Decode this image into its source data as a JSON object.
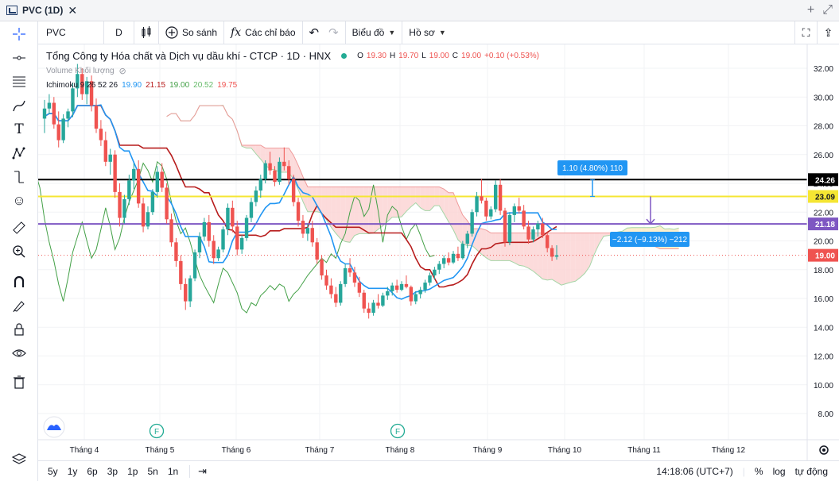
{
  "window": {
    "tab_title": "PVC (1D)",
    "close_glyph": "✕",
    "add_glyph": "+",
    "expand_glyph": "⤢"
  },
  "toolbar": {
    "symbol": "PVC",
    "interval": "D",
    "compare": "So sánh",
    "indicators": "Các chỉ báo",
    "undo_glyph": "↶",
    "redo_glyph": "↷",
    "chart_type": "Biểu đồ",
    "profile": "Hồ sơ",
    "fullscreen_glyph": "⛶",
    "share_glyph": "⇪"
  },
  "legend": {
    "title": "Tổng Công ty Hóa chất và Dịch vụ dầu khí - CTCP · 1D · HNX",
    "o_label": "O",
    "o": "19.30",
    "h_label": "H",
    "h": "19.70",
    "l_label": "L",
    "l": "19.00",
    "c_label": "C",
    "c": "19.00",
    "change": "+0.10 (+0.53%)",
    "volume": "Volume Khối lượng",
    "ichimoku_label": "Ichimoku 9 26 52 26",
    "ichimoku_values": [
      "19.90",
      "21.15",
      "19.00",
      "20.52",
      "19.75"
    ]
  },
  "colors": {
    "up": "#26a69a",
    "down": "#ef5350",
    "conversion": "#2196f3",
    "base": "#b71c1c",
    "lagging": "#43a047",
    "line_black": "#000000",
    "line_yellow": "#f5e633",
    "line_purple": "#7e57c2",
    "cloud_up": "#fbecc4",
    "cloud_down": "#fbd5d5",
    "measure": "#2196f3"
  },
  "price_axis": {
    "labels": [
      "32.00",
      "30.00",
      "28.00",
      "26.00",
      "24.00",
      "22.00",
      "20.00",
      "18.00",
      "16.00",
      "14.00",
      "12.00",
      "10.00",
      "8.00"
    ],
    "tags": [
      {
        "value": "24.26",
        "bg": "#000000",
        "fg": "#ffffff"
      },
      {
        "value": "23.09",
        "bg": "#f5e633",
        "fg": "#131722"
      },
      {
        "value": "21.18",
        "bg": "#7e57c2",
        "fg": "#ffffff"
      },
      {
        "value": "19.00",
        "bg": "#ef5350",
        "fg": "#ffffff"
      }
    ]
  },
  "time_axis": [
    "Tháng 4",
    "Tháng 5",
    "Tháng 6",
    "Tháng 7",
    "Tháng 8",
    "Tháng 9",
    "Tháng 10",
    "Tháng 11",
    "Tháng 12"
  ],
  "markers": [
    "F",
    "F"
  ],
  "measure_labels": [
    "1.10 (4.80%) 110",
    "−2.12 (−9.13%) −212"
  ],
  "bottom": {
    "ranges": [
      "5y",
      "1y",
      "6p",
      "3p",
      "1p",
      "5n",
      "1n"
    ],
    "time": "14:18:06 (UTC+7)",
    "percent": "%",
    "log": "log",
    "auto": "tự động"
  },
  "chart_data": {
    "type": "candlestick",
    "symbol": "PVC",
    "interval": "1D",
    "ylim": [
      7,
      33
    ],
    "horizontal_lines": [
      24.26,
      23.09,
      21.18
    ],
    "last_close": 19.0,
    "candles_ohlc": [
      [
        28.5,
        29.8,
        27.5,
        29.2
      ],
      [
        29.2,
        30.2,
        28.8,
        29.6
      ],
      [
        29.6,
        30.0,
        27.8,
        28.1
      ],
      [
        28.1,
        29.0,
        26.5,
        27.0
      ],
      [
        27.0,
        28.8,
        26.8,
        28.5
      ],
      [
        28.5,
        29.2,
        27.9,
        29.0
      ],
      [
        29.0,
        31.0,
        28.6,
        30.6
      ],
      [
        30.6,
        32.3,
        30.0,
        31.6
      ],
      [
        31.6,
        32.0,
        29.8,
        30.2
      ],
      [
        30.2,
        31.4,
        29.5,
        31.1
      ],
      [
        31.1,
        31.5,
        29.0,
        29.4
      ],
      [
        29.4,
        29.9,
        27.5,
        27.8
      ],
      [
        27.8,
        28.4,
        26.6,
        27.0
      ],
      [
        27.0,
        27.6,
        25.2,
        25.5
      ],
      [
        25.5,
        26.4,
        24.6,
        26.0
      ],
      [
        26.0,
        26.3,
        23.0,
        23.4
      ],
      [
        23.4,
        24.0,
        21.0,
        21.6
      ],
      [
        21.6,
        23.2,
        21.2,
        22.9
      ],
      [
        22.9,
        24.6,
        22.5,
        24.2
      ],
      [
        24.2,
        25.4,
        23.6,
        25.0
      ],
      [
        25.0,
        25.6,
        22.3,
        22.6
      ],
      [
        22.6,
        23.0,
        20.6,
        21.0
      ],
      [
        21.0,
        22.4,
        20.8,
        22.0
      ],
      [
        22.0,
        23.6,
        21.8,
        23.4
      ],
      [
        23.4,
        25.2,
        23.0,
        24.8
      ],
      [
        24.8,
        25.4,
        23.4,
        23.7
      ],
      [
        23.7,
        24.0,
        21.2,
        21.5
      ],
      [
        21.5,
        21.9,
        19.6,
        19.9
      ],
      [
        19.9,
        20.2,
        18.2,
        18.6
      ],
      [
        18.6,
        19.0,
        16.6,
        17.0
      ],
      [
        17.0,
        17.4,
        15.2,
        15.8
      ],
      [
        15.8,
        17.6,
        15.4,
        17.4
      ],
      [
        17.4,
        19.4,
        17.2,
        19.2
      ],
      [
        19.2,
        20.6,
        18.8,
        20.3
      ],
      [
        20.3,
        21.6,
        20.0,
        21.3
      ],
      [
        21.3,
        21.8,
        19.6,
        20.0
      ],
      [
        20.0,
        20.4,
        18.4,
        18.8
      ],
      [
        18.8,
        19.6,
        18.6,
        19.4
      ],
      [
        19.4,
        21.0,
        19.2,
        20.8
      ],
      [
        20.8,
        22.6,
        20.4,
        22.3
      ],
      [
        22.3,
        22.8,
        20.6,
        21.0
      ],
      [
        21.0,
        21.4,
        19.0,
        19.4
      ],
      [
        19.4,
        20.4,
        19.1,
        20.2
      ],
      [
        20.2,
        21.8,
        20.0,
        21.6
      ],
      [
        21.6,
        23.0,
        21.3,
        22.7
      ],
      [
        22.7,
        23.8,
        22.4,
        23.5
      ],
      [
        23.5,
        24.6,
        23.0,
        24.3
      ],
      [
        24.3,
        25.6,
        24.0,
        25.4
      ],
      [
        25.4,
        26.2,
        24.6,
        24.9
      ],
      [
        24.9,
        25.2,
        23.8,
        24.1
      ],
      [
        24.1,
        25.8,
        23.9,
        25.5
      ],
      [
        25.5,
        26.5,
        24.9,
        25.2
      ],
      [
        25.2,
        25.6,
        23.9,
        24.3
      ],
      [
        24.3,
        24.6,
        22.4,
        22.7
      ],
      [
        22.7,
        23.0,
        21.0,
        21.4
      ],
      [
        21.4,
        21.8,
        20.2,
        20.5
      ],
      [
        20.5,
        21.2,
        20.0,
        20.9
      ],
      [
        20.9,
        21.4,
        19.6,
        19.9
      ],
      [
        19.9,
        20.2,
        18.4,
        18.7
      ],
      [
        18.7,
        19.0,
        17.3,
        17.6
      ],
      [
        17.6,
        18.0,
        16.6,
        16.9
      ],
      [
        16.9,
        17.4,
        16.0,
        16.3
      ],
      [
        16.3,
        16.8,
        15.4,
        15.7
      ],
      [
        15.7,
        17.2,
        15.5,
        17.0
      ],
      [
        17.0,
        18.4,
        16.8,
        18.1
      ],
      [
        18.1,
        18.8,
        17.5,
        17.8
      ],
      [
        17.8,
        18.2,
        16.8,
        17.1
      ],
      [
        17.1,
        17.5,
        16.1,
        16.4
      ],
      [
        16.4,
        16.6,
        15.0,
        15.3
      ],
      [
        15.3,
        15.7,
        14.6,
        15.0
      ],
      [
        15.0,
        15.9,
        14.8,
        15.7
      ],
      [
        15.7,
        16.3,
        15.3,
        15.5
      ],
      [
        15.5,
        16.4,
        15.4,
        16.2
      ],
      [
        16.2,
        16.8,
        15.9,
        16.5
      ],
      [
        16.5,
        17.1,
        16.2,
        16.9
      ],
      [
        16.9,
        17.3,
        16.4,
        16.6
      ],
      [
        16.6,
        17.2,
        16.5,
        17.0
      ],
      [
        17.0,
        17.6,
        16.7,
        16.8
      ],
      [
        16.8,
        16.9,
        15.5,
        15.8
      ],
      [
        15.8,
        16.5,
        15.6,
        16.3
      ],
      [
        16.3,
        16.8,
        16.0,
        16.6
      ],
      [
        16.6,
        17.3,
        16.4,
        17.1
      ],
      [
        17.1,
        17.8,
        16.9,
        17.6
      ],
      [
        17.6,
        18.2,
        17.3,
        18.0
      ],
      [
        18.0,
        18.6,
        17.7,
        18.4
      ],
      [
        18.4,
        19.0,
        18.1,
        18.8
      ],
      [
        18.8,
        19.2,
        18.3,
        18.5
      ],
      [
        18.5,
        19.3,
        18.4,
        19.1
      ],
      [
        19.1,
        19.6,
        18.6,
        18.8
      ],
      [
        18.8,
        20.0,
        18.7,
        19.8
      ],
      [
        19.8,
        20.7,
        19.5,
        20.5
      ],
      [
        20.5,
        22.2,
        20.3,
        22.0
      ],
      [
        22.0,
        23.4,
        21.7,
        23.1
      ],
      [
        23.1,
        24.3,
        22.6,
        22.8
      ],
      [
        22.8,
        23.0,
        21.4,
        21.7
      ],
      [
        21.7,
        22.4,
        21.5,
        22.2
      ],
      [
        22.2,
        24.2,
        22.0,
        23.9
      ],
      [
        23.9,
        24.3,
        21.8,
        22.1
      ],
      [
        22.1,
        22.3,
        19.6,
        19.9
      ],
      [
        19.9,
        22.0,
        19.7,
        21.8
      ],
      [
        21.8,
        22.6,
        21.3,
        22.4
      ],
      [
        22.4,
        23.0,
        21.9,
        22.1
      ],
      [
        22.1,
        22.5,
        20.8,
        21.0
      ],
      [
        21.0,
        21.4,
        19.8,
        20.1
      ],
      [
        20.1,
        21.0,
        19.9,
        20.8
      ],
      [
        20.8,
        21.4,
        20.3,
        21.2
      ],
      [
        21.2,
        21.6,
        20.2,
        20.4
      ],
      [
        20.4,
        20.6,
        19.2,
        19.5
      ],
      [
        19.5,
        19.7,
        18.6,
        18.9
      ],
      [
        18.9,
        19.7,
        18.7,
        19.0
      ]
    ]
  }
}
